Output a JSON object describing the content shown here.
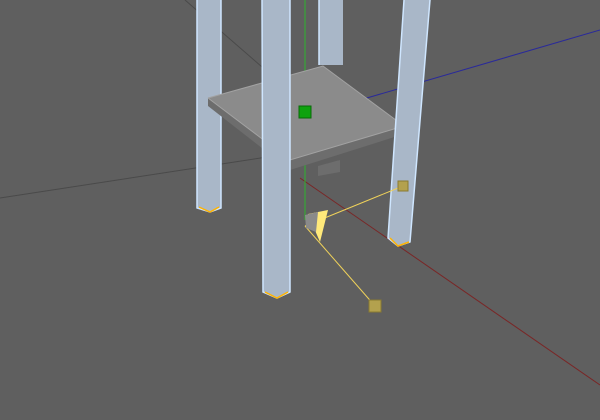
{
  "viewport": {
    "background_color": "#5f5f5f",
    "grid_color": "#4a4a4a",
    "x_axis_color": "#7a2626",
    "y_axis_color": "#2cb52c",
    "z_axis_color": "#2a2a9a"
  },
  "object": {
    "type": "stool",
    "leg_count": 4,
    "leg_fill_color": "#a9b7c8",
    "leg_edge_color": "#cfe6ff",
    "leg_foot_color": "#ffb300",
    "seat_top_color": "#8b8b8b",
    "seat_edge_color": "#a2a2a2",
    "seat_underside_color": "#6d6d6d"
  },
  "gizmo": {
    "pivot_handle_color": "#0ea20e",
    "light_color": "#ffe97a",
    "light_line_color": "#f0d25a",
    "target_handle_color": "#b3a14e",
    "icons": [
      "move-pivot-icon",
      "spotlight-icon",
      "light-target-handle-icon",
      "light-source-handle-icon"
    ]
  }
}
